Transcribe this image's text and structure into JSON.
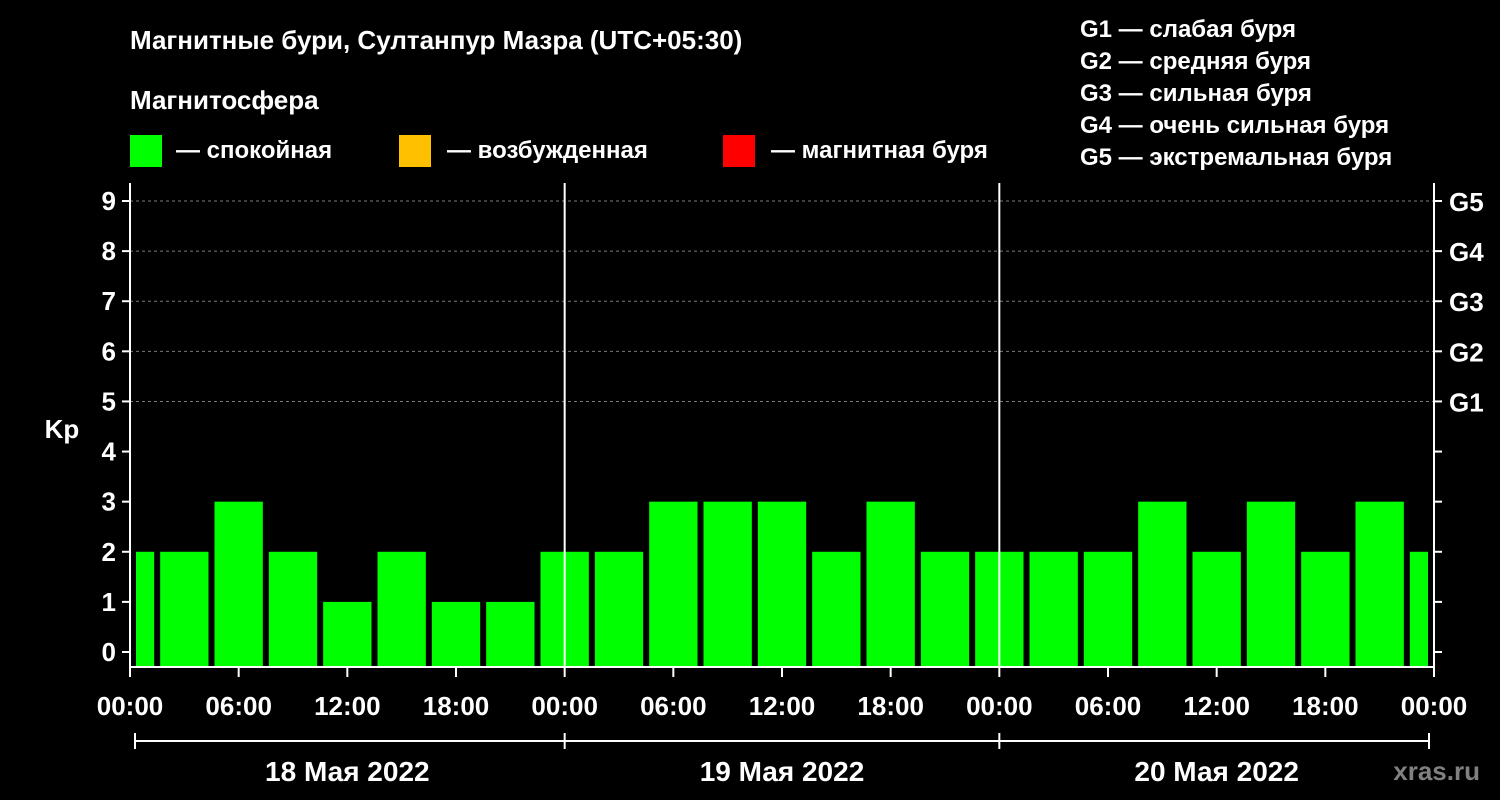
{
  "chart_data": {
    "type": "bar",
    "title": "Магнитные бури, Султанпур Мазра (UTC+05:30)",
    "ylabel": "Kp",
    "ylim": [
      0,
      9
    ],
    "y_ticks": [
      "0",
      "1",
      "2",
      "3",
      "4",
      "5",
      "6",
      "7",
      "8",
      "9"
    ],
    "legend": {
      "title": "Магнитосфера",
      "items": [
        {
          "label": "— спокойная",
          "color": "#00ff00"
        },
        {
          "label": "— возбужденная",
          "color": "#ffc000"
        },
        {
          "label": "— магнитная буря",
          "color": "#ff0000"
        }
      ]
    },
    "storm_scale": [
      {
        "level": "G1",
        "kp": 5,
        "text": "G1 — слабая буря"
      },
      {
        "level": "G2",
        "kp": 6,
        "text": "G2 — средняя буря"
      },
      {
        "level": "G3",
        "kp": 7,
        "text": "G3 — сильная буря"
      },
      {
        "level": "G4",
        "kp": 8,
        "text": "G4 — очень сильная буря"
      },
      {
        "level": "G5",
        "kp": 9,
        "text": "G5 — экстремальная буря"
      }
    ],
    "x_tick_labels": [
      "00:00",
      "06:00",
      "12:00",
      "18:00",
      "00:00",
      "06:00",
      "12:00",
      "18:00",
      "00:00",
      "06:00",
      "12:00",
      "18:00",
      "00:00"
    ],
    "days": [
      "18 Мая 2022",
      "19 Мая 2022",
      "20 Мая 2022"
    ],
    "interval_hours": 3,
    "timeline_start_hour": 0,
    "timeline_end_hour": 72,
    "first_bar_start_hour": -1.5,
    "values": [
      2,
      2,
      3,
      2,
      1,
      2,
      1,
      1,
      2,
      2,
      3,
      3,
      3,
      2,
      3,
      2,
      2,
      2,
      2,
      3,
      2,
      3,
      2,
      3,
      2
    ],
    "grid": true
  },
  "watermark": "xras.ru"
}
